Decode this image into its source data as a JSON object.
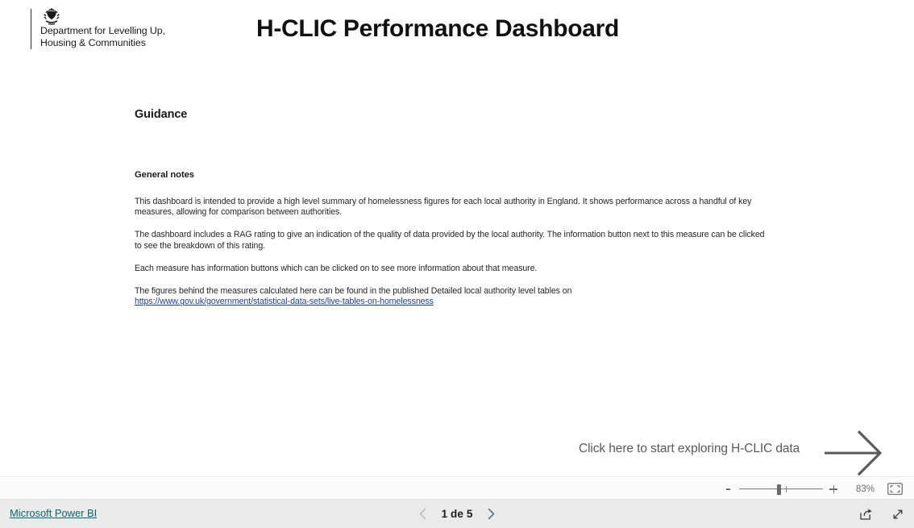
{
  "report": {
    "title": "H-CLIC Performance Dashboard",
    "logo": {
      "crest_icon": "royal-crest-icon",
      "line1": "Department for Levelling Up,",
      "line2": "Housing & Communities"
    },
    "guidance": {
      "heading": "Guidance",
      "sub_heading": "General notes",
      "paragraphs": [
        "This dashboard is intended to provide a high level summary of homelessness figures for each local authority in England. It shows performance across a handful of key measures, allowing for comparison between authorities.",
        "The dashboard includes a RAG rating to give an indication of the quality of data provided by the local authority. The information button next to this measure can be clicked to see the breakdown of this rating.",
        "Each measure has information buttons which can be clicked on to see more information about that measure.",
        "The figures behind the measures calculated here can be found in the published Detailed local authority level tables on"
      ],
      "source_link_text": "https://www.gov.uk/government/statistical-data-sets/live-tables-on-homelessness",
      "source_link_color": "#1f3f87"
    },
    "call_to_action": {
      "label": "Click here to start exploring H-CLIC data",
      "arrow_icon": "arrow-right-icon",
      "color": "#595959"
    }
  },
  "zoom_bar": {
    "minus_icon": "zoom-out-icon",
    "plus_icon": "zoom-in-icon",
    "level": "83%",
    "slider_position_percent": 46,
    "fit_to_page_icon": "fit-to-page-icon"
  },
  "footer": {
    "powerbi_label": "Microsoft Power BI",
    "powerbi_color": "#10656d",
    "prev_page_icon": "chevron-left-icon",
    "next_page_icon": "chevron-right-icon",
    "page_indicator": "1 de 5",
    "share_icon": "share-export-icon",
    "fullscreen_icon": "fullscreen-expand-icon"
  }
}
